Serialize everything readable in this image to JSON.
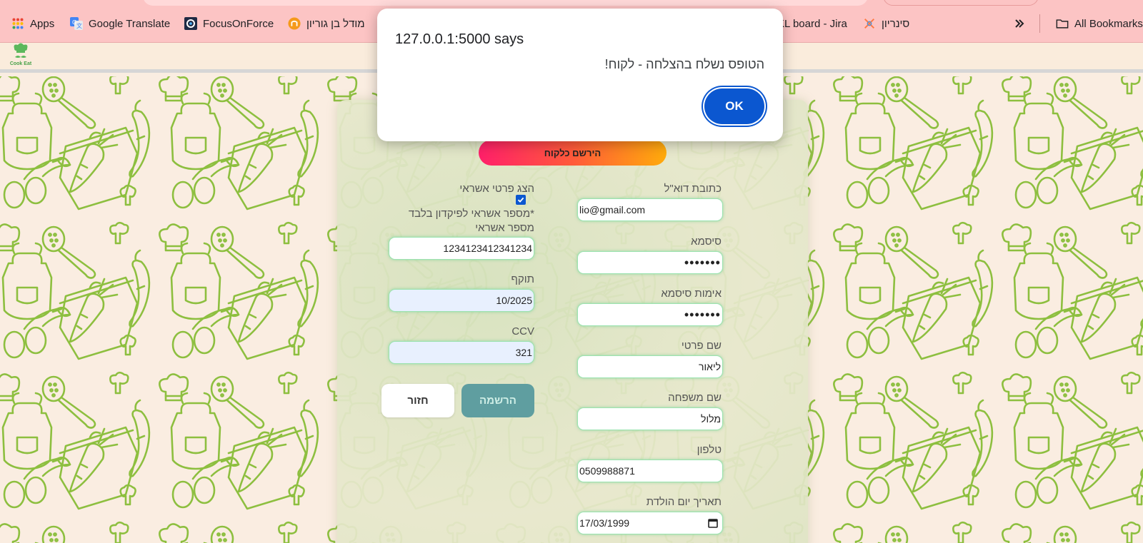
{
  "browser": {
    "bookmarks": [
      {
        "label": "Apps",
        "icon": "apps-grid-icon"
      },
      {
        "label": "Google Translate",
        "icon": "google-translate-icon"
      },
      {
        "label": "FocusOnForce",
        "icon": "focusonforce-icon"
      },
      {
        "label": "מודל בן גוריון",
        "icon": "moodle-icon"
      },
      {
        "label": "KL board - Jira",
        "icon": "jira-icon"
      },
      {
        "label": "סינריון",
        "icon": "cinerion-icon"
      },
      {
        "label": "All Bookmarks",
        "icon": "folder-icon"
      }
    ],
    "overflow_icon": "double-chevron-right-icon"
  },
  "app": {
    "logo_text": "Cook Eat"
  },
  "form": {
    "tab_label": "הירשם כלקוח",
    "email": {
      "label": "כתובת דוא\"ל",
      "value": "lio@gmail.com"
    },
    "password": {
      "label": "סיסמא",
      "value": "•••••••"
    },
    "confirm_password": {
      "label": "אימות סיסמא",
      "value": "•••••••"
    },
    "first_name": {
      "label": "שם פרטי",
      "value": "ליאור"
    },
    "last_name": {
      "label": "שם משפחה",
      "value": "מלול"
    },
    "phone": {
      "label": "טלפון",
      "value": "0509988871"
    },
    "birth_date": {
      "label": "תאריך יום הולדת",
      "value": "17/03/1999"
    },
    "show_credit": {
      "label": "הצג פרטי אשראי",
      "checked": true
    },
    "credit_note": "*מספר אשראי לפיקדון בלבד",
    "card_number": {
      "label": "מספר אשראי",
      "value": "1234123412341234"
    },
    "expiry": {
      "label": "תוקף",
      "value": "10/2025"
    },
    "ccv": {
      "label": "CCV",
      "value": "321"
    },
    "register_button": "הרשמה",
    "back_button": "חזור"
  },
  "dialog": {
    "title": "127.0.0.1:5000 says",
    "message": "הטופס נשלח בהצלחה - לקוח!",
    "ok_label": "OK"
  },
  "colors": {
    "bookmarks_bar": "#fcc4c4",
    "header": "#faecdc",
    "pattern_line": "#8dbf3f",
    "tab_gradient_start": "#ff1f6a",
    "tab_gradient_end": "#ffab0b",
    "register_button": "#5f9ea0",
    "dialog_button": "#0b57d0"
  }
}
